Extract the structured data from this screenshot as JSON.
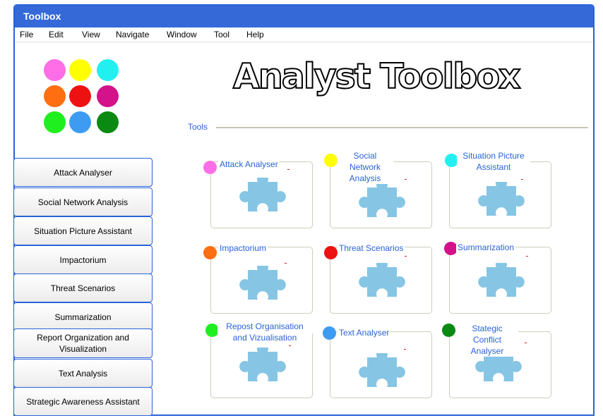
{
  "window": {
    "title": "Toolbox"
  },
  "menu": [
    "File",
    "Edit",
    "View",
    "Navigate",
    "Window",
    "Tool",
    "Help"
  ],
  "colors": {
    "titlebar": "#3569d8",
    "accent": "#2a62d9",
    "palette": [
      "#ff6ee6",
      "#ffff00",
      "#22f0f0",
      "#ff6f11",
      "#ee1111",
      "#d4128a",
      "#1fef1f",
      "#3d9cf2",
      "#0a8a12"
    ],
    "puzzle": "#86c5e4"
  },
  "app_title": "Analyst Toolbox",
  "tools_label": "Tools",
  "sidebar": [
    "Attack Analyser",
    "Social Network Analysis",
    "Situation Picture Assistant",
    "Impactorium",
    "Threat Scenarios",
    "Summarization",
    "Report Organization and Visualization",
    "Text Analysis",
    "Strategic Awareness Assistant"
  ],
  "tools": [
    {
      "label": "Attack Analyser",
      "icon": "puzzle-icon"
    },
    {
      "label": "Social Network Analysis",
      "icon": "puzzle-icon"
    },
    {
      "label": "Situation Picture Assistant",
      "icon": "puzzle-icon"
    },
    {
      "label": "Impactorium",
      "icon": "puzzle-icon"
    },
    {
      "label": "Threat Scenarios",
      "icon": "puzzle-icon"
    },
    {
      "label": "Summarization",
      "icon": "puzzle-icon"
    },
    {
      "label": "Repost Organisation and Vizualisation",
      "icon": "puzzle-icon"
    },
    {
      "label": "Text Analyser",
      "icon": "puzzle-icon"
    },
    {
      "label": "Stategic Conflict Analyser",
      "icon": "puzzle-icon"
    }
  ]
}
